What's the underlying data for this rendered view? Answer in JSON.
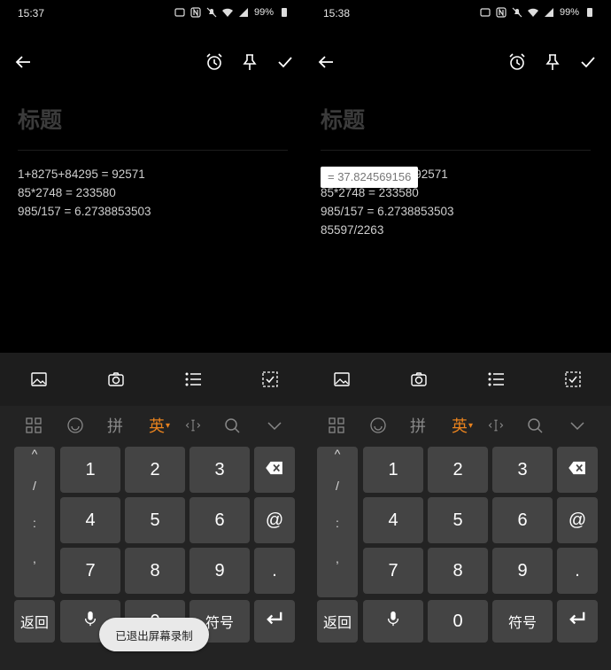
{
  "left": {
    "time": "15:37",
    "battery": "99%",
    "title": "标题",
    "lines": [
      "1+8275+84295 = 92571",
      "85*2748 = 233580",
      "985/157 = 6.2738853503"
    ]
  },
  "right": {
    "time": "15:38",
    "battery": "99%",
    "title": "标题",
    "lines": [
      "1+8275+84295 = 92571",
      "85*2748 = 233580",
      "985/157 = 6.2738853503",
      "85597/2263"
    ],
    "popup": "= 37.824569156"
  },
  "ime": {
    "lang": "英",
    "pinyin": "拼"
  },
  "keys": {
    "side": [
      "^",
      "/",
      ":",
      ","
    ],
    "nums": [
      "1",
      "2",
      "3",
      "4",
      "5",
      "6",
      "7",
      "8",
      "9",
      "0"
    ],
    "at": "@",
    "dot": ".",
    "back": "返回",
    "symbols": "符号"
  },
  "toast": "已退出屏幕录制",
  "colors": {
    "accent": "#e8821e",
    "background": "#000000",
    "key": "#444444"
  },
  "icons": [
    "back-arrow-icon",
    "alarm-icon",
    "pin-icon",
    "check-icon",
    "image-icon",
    "camera-icon",
    "list-icon",
    "checkbox-icon",
    "grid-icon",
    "emoji-icon",
    "cursor-icon",
    "search-icon",
    "chevron-down-icon",
    "backspace-icon",
    "mic-icon",
    "enter-icon"
  ]
}
